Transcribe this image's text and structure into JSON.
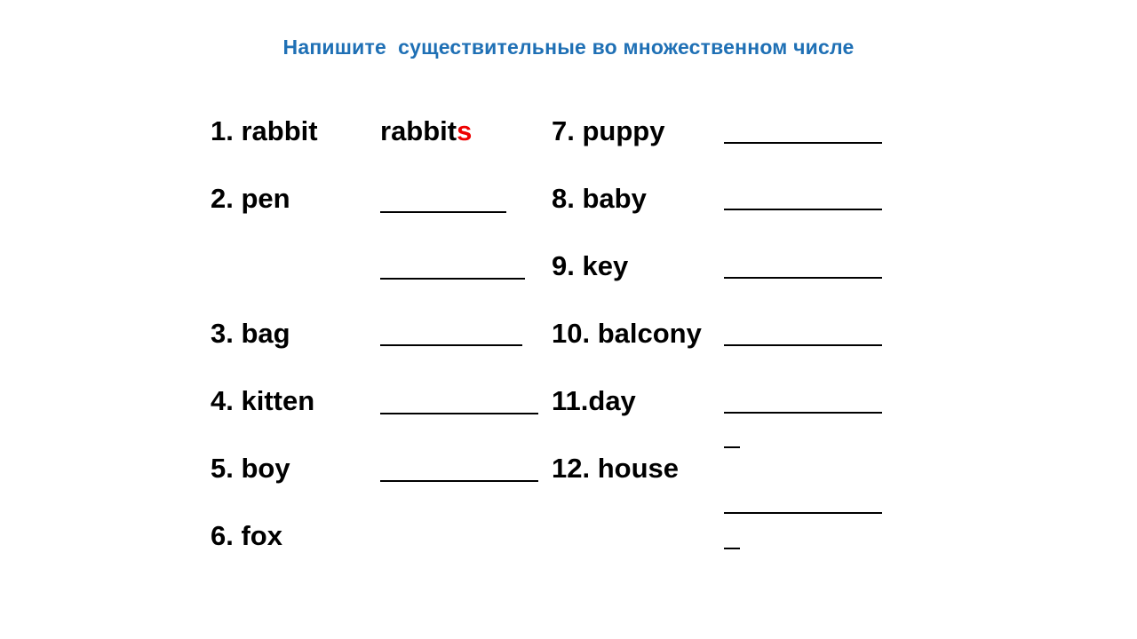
{
  "slide": {
    "title": "Напишите  существительные во множественном числе",
    "title_color": "#1f70b5",
    "background_color": "#ffffff",
    "text_color": "#000000",
    "accent_color": "#ee0000"
  },
  "columns": [
    {
      "name": "left-column",
      "items": [
        {
          "label": "1. rabbit",
          "answer_stem": "rabbit",
          "answer_suffix": "s",
          "blank": false
        },
        {
          "label": "2. pen",
          "answer_stem": "",
          "answer_suffix": "",
          "blank": true
        },
        {
          "label": "",
          "answer_stem": "",
          "answer_suffix": "",
          "blank": true
        },
        {
          "label": "3. bag",
          "answer_stem": "",
          "answer_suffix": "",
          "blank": true
        },
        {
          "label": "4. kitten",
          "answer_stem": "",
          "answer_suffix": "",
          "blank": true
        },
        {
          "label": "5. boy",
          "answer_stem": "",
          "answer_suffix": "",
          "blank": true
        },
        {
          "label": "6. fox",
          "answer_stem": "",
          "answer_suffix": "",
          "blank": false
        }
      ]
    },
    {
      "name": "right-column",
      "items": [
        {
          "label": "7. puppy",
          "answer_stem": "",
          "answer_suffix": "",
          "blank": true
        },
        {
          "label": "8. baby",
          "answer_stem": "",
          "answer_suffix": "",
          "blank": true
        },
        {
          "label": "9. key",
          "answer_stem": "",
          "answer_suffix": "",
          "blank": true
        },
        {
          "label": "10. balcony",
          "answer_stem": "",
          "answer_suffix": "",
          "blank": true
        },
        {
          "label": "11.day",
          "answer_stem": "",
          "answer_suffix": "",
          "blank": true
        },
        {
          "label": "",
          "answer_stem": "",
          "answer_suffix": "",
          "blank": true
        },
        {
          "label": "12. house",
          "answer_stem": "",
          "answer_suffix": "",
          "blank": true
        },
        {
          "label": "",
          "answer_stem": "",
          "answer_suffix": "",
          "blank": true
        }
      ]
    }
  ],
  "labels": {
    "item_1": "1. rabbit",
    "item_2": "2. pen",
    "item_3": "3. bag",
    "item_4": "4. kitten",
    "item_5": "5. boy",
    "item_6": "6. fox",
    "item_7": "7. puppy",
    "item_8": "8. baby",
    "item_9": "9. key",
    "item_10": "10. balcony",
    "item_11": "11.day",
    "item_12": "12. house",
    "answer_1_stem": "rabbit",
    "answer_1_suffix": "s"
  }
}
